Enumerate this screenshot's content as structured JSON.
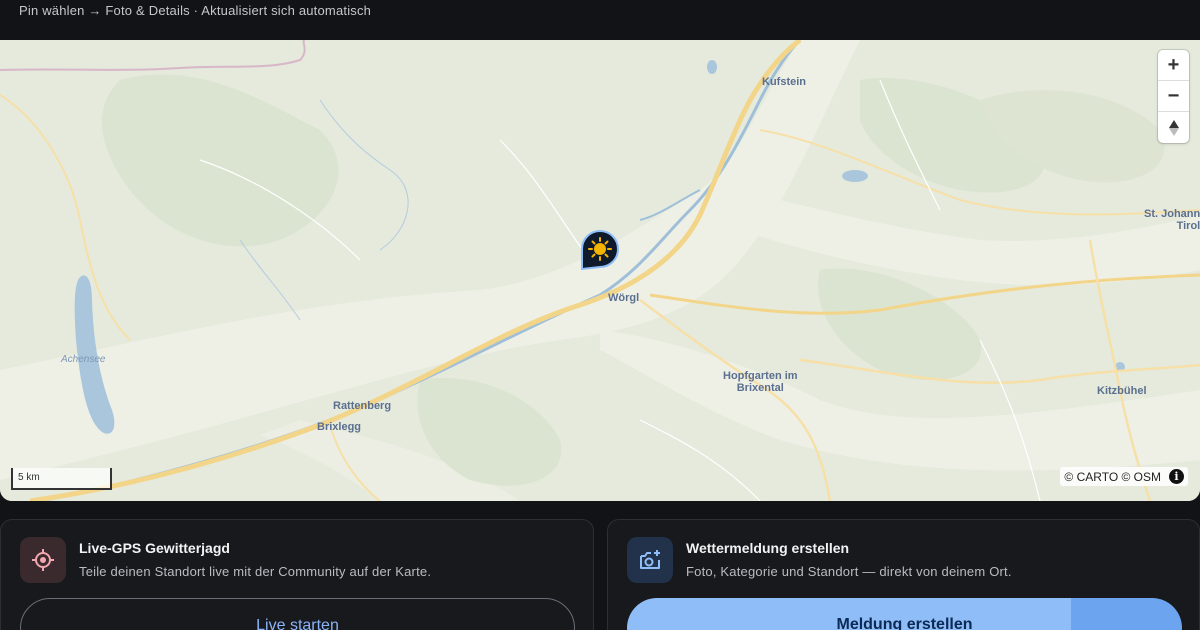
{
  "header": {
    "hint": "Pin wählen → Foto & Details · Aktualisiert sich automatisch"
  },
  "map": {
    "places": {
      "kufstein": "Kufstein",
      "woergl": "Wörgl",
      "st_johann_1": "St. Johann",
      "st_johann_2": "Tirol",
      "achensee": "Achensee",
      "hopfgarten_1": "Hopfgarten im",
      "hopfgarten_2": "Brixental",
      "rattenberg": "Rattenberg",
      "brixlegg": "Brixlegg",
      "kitzbuehel": "Kitzbühel"
    },
    "zoom_in": "+",
    "zoom_out": "−",
    "reset_north": "▲",
    "scale_label": "5 km",
    "attribution": "© CARTO © OSM",
    "info": "i",
    "pin_icon": "sun-icon"
  },
  "cards": {
    "live": {
      "icon": "target-icon",
      "title": "Live-GPS Gewitterjagd",
      "subtitle": "Teile deinen Standort live mit der Community auf der Karte.",
      "button": "Live starten"
    },
    "report": {
      "icon": "camera-plus-icon",
      "title": "Wettermeldung erstellen",
      "subtitle": "Foto, Kategorie und Standort — direkt von deinem Ort.",
      "button": "Meldung erstellen"
    }
  },
  "colors": {
    "background": "#111316",
    "card": "#17191d",
    "accent_blue": "#8fbdf8",
    "pin": "#0f1b2d",
    "sun": "#f5b400"
  }
}
